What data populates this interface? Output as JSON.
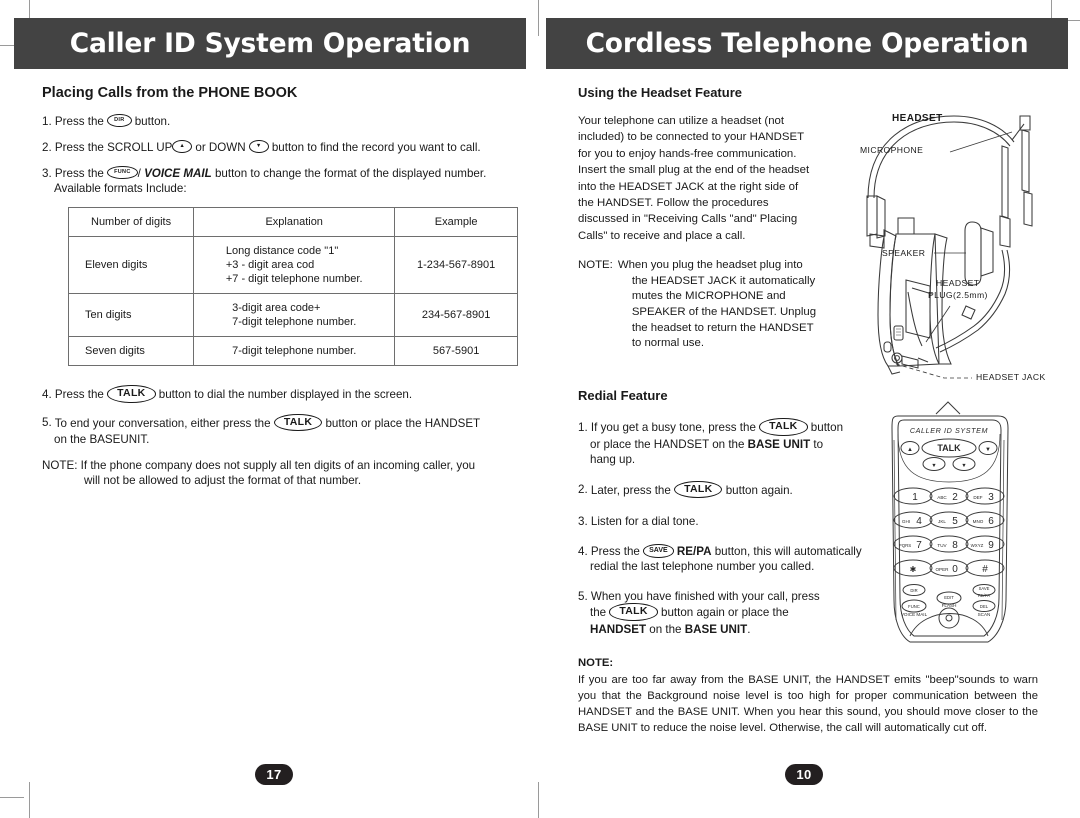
{
  "document": {
    "type": "user-manual-spread",
    "banner_color": "#434343",
    "page_number_pill_color": "#231f20"
  },
  "left_page": {
    "banner_title": "Caller ID System Operation",
    "section_title": "Placing Calls from the PHONE BOOK",
    "steps": [
      {
        "num": "1.",
        "pre": "Press the",
        "key": "DIR",
        "post": "button."
      },
      {
        "num": "2.",
        "pre": "Press the SCROLL UP",
        "key": "▲",
        "mid": "or DOWN",
        "key2": "▼",
        "post": "button to find the record you want to call."
      },
      {
        "num": "3.",
        "pre": "Press the",
        "key": "FUNC",
        "sep": "/",
        "emph": "VOICE MAIL",
        "post": "button to change the format of the displayed number.",
        "second_line": "Available formats Include:"
      }
    ],
    "table": {
      "headers": [
        "Number of digits",
        "Explanation",
        "Example"
      ],
      "rows": [
        {
          "digits": "Eleven digits",
          "explanation": [
            "Long distance code \"1\"",
            "+3 - digit area cod",
            "+7 - digit telephone number."
          ],
          "example": "1-234-567-8901"
        },
        {
          "digits": "Ten digits",
          "explanation": [
            "3-digit area code+",
            "7-digit telephone number."
          ],
          "example": "234-567-8901"
        },
        {
          "digits": "Seven digits",
          "explanation": [
            "7-digit telephone number."
          ],
          "example": "567-5901"
        }
      ]
    },
    "steps_after": [
      {
        "num": "4.",
        "pre": "Press the",
        "key": "TALK",
        "post": "button to dial the number displayed in the screen."
      },
      {
        "num": "5.",
        "pre": "To end your conversation, either press the",
        "key": "TALK",
        "post": "button  or place the HANDSET",
        "second_line": "on the BASEUNIT."
      }
    ],
    "note": {
      "label": "NOTE:",
      "line1": "If the phone company does not supply all ten digits of an incoming caller, you",
      "line2": "will not be allowed to adjust the format of that number."
    },
    "page_number": "17"
  },
  "right_page": {
    "banner_title": "Cordless Telephone Operation",
    "headset_section": {
      "title": "Using the Headset Feature",
      "paragraph_lines": [
        "Your  telephone can utilize  a  headset   (not",
        "included) to be connected to your HANDSET",
        "for you  to  enjoy  hands-free  communication.",
        "Insert the small plug at the end of the headset",
        "into the HEADSET  JACK  at  the right side of",
        "the    HANDSET.  Follow    the    procedures",
        "discussed  in  \"Receiving Calls  \"and\"  Placing",
        "Calls\"  to receive and place a call."
      ],
      "note_label": "NOTE:",
      "note_lines": [
        "When you plug the headset plug into",
        "the HEADSET JACK it automatically",
        "mutes    the    MICROPHONE    and",
        "SPEAKER of  the HANDSET.  Unplug",
        "the headset to return  the  HANDSET",
        "to normal use."
      ]
    },
    "headset_diagram": {
      "title": "HEADSET",
      "labels": [
        "MICROPHONE",
        "SPEAKER",
        "HEADSET",
        "PLUG(2.5mm)",
        "HEADSET JACK"
      ]
    },
    "redial_section": {
      "title": "Redial Feature",
      "steps": [
        {
          "num": "1.",
          "pre": "If you get a busy tone, press the",
          "key": "TALK",
          "post": "button",
          "line2_a": "or place the HANDSET on the ",
          "line2_b": "BASE UNIT",
          "line2_c": " to",
          "line3": "hang up."
        },
        {
          "num": "2.",
          "pre": "Later, press the",
          "key": "TALK",
          "post": "button again."
        },
        {
          "num": "3.",
          "text": "Listen for a dial tone."
        },
        {
          "num": "4.",
          "pre": "Press the",
          "key": "SAVE",
          "bold": "RE/PA",
          "post": "button, this will automatically",
          "line2": "redial the last telephone number you called."
        },
        {
          "num": "5.",
          "text": "When you have finished with your call,  press",
          "pre2": "the",
          "key": "TALK",
          "post2": "button again or place the",
          "line3_a": "HANDSET",
          "line3_b": " on the ",
          "line3_c": "BASE UNIT",
          "line3_d": "."
        }
      ]
    },
    "handset_diagram": {
      "brand": "CALLER  ID  SYSTEM",
      "talk_key": "TALK",
      "keys": [
        {
          "sub": "",
          "main": "1"
        },
        {
          "sub": "ABC",
          "main": "2"
        },
        {
          "sub": "DEF",
          "main": "3"
        },
        {
          "sub": "GHI",
          "main": "4"
        },
        {
          "sub": "JKL",
          "main": "5"
        },
        {
          "sub": "MNO",
          "main": "6"
        },
        {
          "sub": "PQRS",
          "main": "7"
        },
        {
          "sub": "TUV",
          "main": "8"
        },
        {
          "sub": "WXYZ",
          "main": "9"
        },
        {
          "sub": "",
          "main": "✳"
        },
        {
          "sub": "OPER",
          "main": "0"
        },
        {
          "sub": "",
          "main": "#"
        }
      ],
      "function_keys": [
        {
          "key": "DIR",
          "caption": ""
        },
        {
          "key": "SAVE",
          "caption": "RE/PA"
        },
        {
          "key": "EDIT",
          "caption": "FLASH"
        },
        {
          "key": "FUNC",
          "caption": "VOICE MAIL"
        },
        {
          "key": "DEL",
          "caption": "SCAN"
        }
      ]
    },
    "bottom_note": {
      "label": "NOTE:",
      "lines": [
        "If you are too far away from the BASE UNIT, the HANDSET emits \"beep\"sounds to warn",
        "you that the Background  noise level is too high for proper communication  between  the",
        "HANDSET and the BASE UNIT. When you hear this sound, you should  move  closer to",
        "the BASE UNIT to reduce the noise level. Otherwise,  the  call  will automatically cut off."
      ]
    },
    "page_number": "10"
  }
}
